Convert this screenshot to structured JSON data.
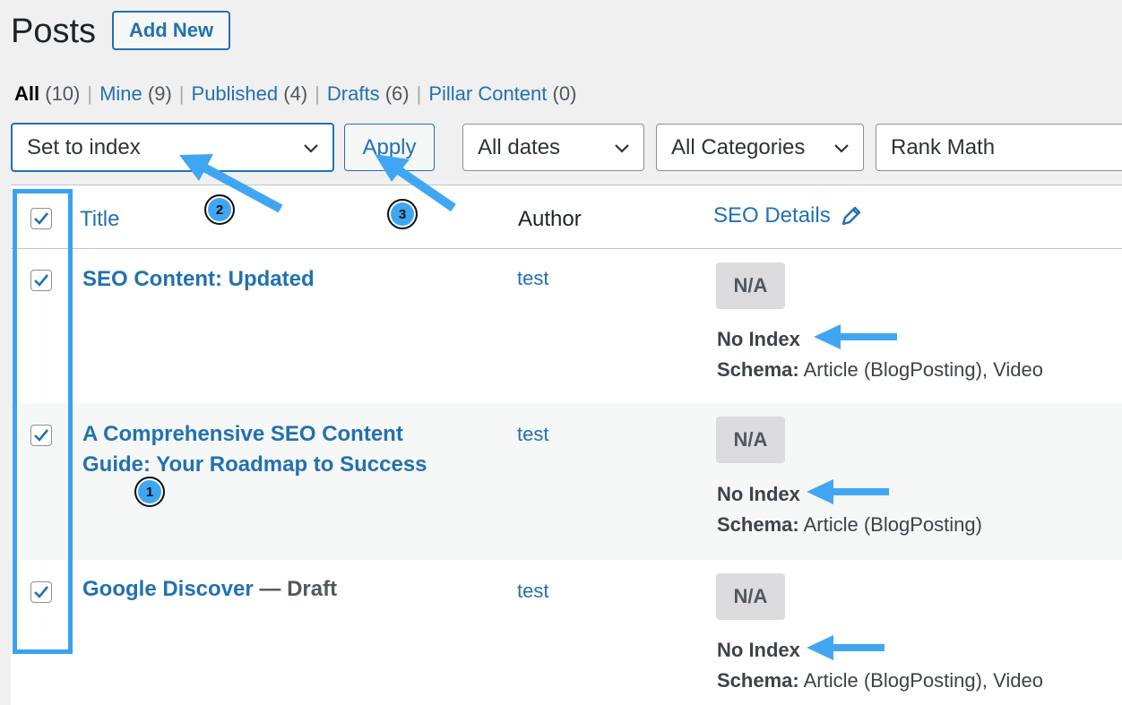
{
  "page": {
    "title": "Posts",
    "add_new": "Add New"
  },
  "filters": {
    "views": [
      {
        "label": "All",
        "count": "(10)"
      },
      {
        "label": "Mine",
        "count": "(9)"
      },
      {
        "label": "Published",
        "count": "(4)"
      },
      {
        "label": "Drafts",
        "count": "(6)"
      },
      {
        "label": "Pillar Content",
        "count": "(0)"
      }
    ],
    "separator": "|"
  },
  "tablenav": {
    "bulk_action": "Set to index",
    "apply": "Apply",
    "dates": "All dates",
    "categories": "All Categories",
    "rank_math": "Rank Math"
  },
  "table": {
    "headers": {
      "title": "Title",
      "author": "Author",
      "seo": "SEO Details"
    },
    "rows": [
      {
        "title": "SEO Content: Updated",
        "state": "",
        "author": "test",
        "score": "N/A",
        "robots": "No Index",
        "schema_label": "Schema:",
        "schema": " Article (BlogPosting), Video"
      },
      {
        "title": "A Comprehensive SEO Content Guide: Your Roadmap to Success",
        "state": "",
        "author": "test",
        "score": "N/A",
        "robots": "No Index",
        "schema_label": "Schema:",
        "schema": " Article (BlogPosting)"
      },
      {
        "title": "Google Discover",
        "state": " — Draft",
        "author": "test",
        "score": "N/A",
        "robots": "No Index",
        "schema_label": "Schema:",
        "schema": " Article (BlogPosting), Video"
      }
    ]
  },
  "annotations": {
    "step1": "1",
    "step2": "2",
    "step3": "3",
    "color": "#41a6f2"
  }
}
